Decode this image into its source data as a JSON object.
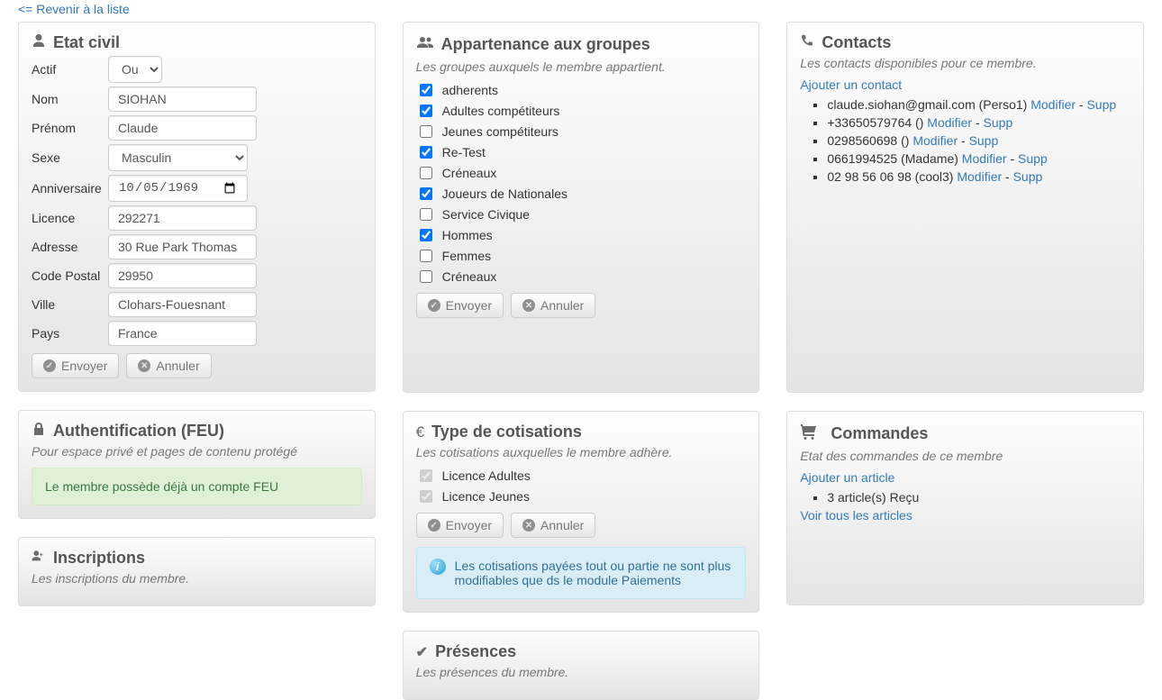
{
  "back_link": "<= Revenir à la liste",
  "civil": {
    "title": "Etat civil",
    "fields": {
      "actif": {
        "label": "Actif",
        "selected": "Oui"
      },
      "nom": {
        "label": "Nom",
        "value": "SIOHAN"
      },
      "prenom": {
        "label": "Prénom",
        "value": "Claude"
      },
      "sexe": {
        "label": "Sexe",
        "selected": "Masculin"
      },
      "anniversaire": {
        "label": "Anniversaire",
        "value": "1969-10-05",
        "display": "05/10/1969"
      },
      "licence": {
        "label": "Licence",
        "value": "292271"
      },
      "adresse": {
        "label": "Adresse",
        "value": "30 Rue Park Thomas"
      },
      "code_postal": {
        "label": "Code Postal",
        "value": "29950"
      },
      "ville": {
        "label": "Ville",
        "value": "Clohars-Fouesnant"
      },
      "pays": {
        "label": "Pays",
        "value": "France"
      }
    },
    "submit": "Envoyer",
    "cancel": "Annuler"
  },
  "auth": {
    "title": "Authentification (FEU)",
    "subtitle": "Pour espace privé et pages de contenu protégé",
    "message": "Le membre possède déjà un compte FEU"
  },
  "groups": {
    "title": "Appartenance aux groupes",
    "subtitle": "Les groupes auxquels le membre appartient.",
    "items": [
      {
        "label": "adherents",
        "checked": true
      },
      {
        "label": "Adultes compétiteurs",
        "checked": true
      },
      {
        "label": "Jeunes compétiteurs",
        "checked": false
      },
      {
        "label": "Re-Test",
        "checked": true
      },
      {
        "label": "Créneaux",
        "checked": false
      },
      {
        "label": "Joueurs de Nationales",
        "checked": true
      },
      {
        "label": "Service Civique",
        "checked": false
      },
      {
        "label": "Hommes",
        "checked": true
      },
      {
        "label": "Femmes",
        "checked": false
      },
      {
        "label": "Créneaux",
        "checked": false
      }
    ],
    "submit": "Envoyer",
    "cancel": "Annuler"
  },
  "cotisations": {
    "title": "Type de cotisations",
    "subtitle": "Les cotisations auxquelles le membre adhère.",
    "items": [
      {
        "label": "Licence Adultes",
        "checked": true,
        "disabled": true
      },
      {
        "label": "Licence Jeunes",
        "checked": true,
        "disabled": true
      }
    ],
    "submit": "Envoyer",
    "cancel": "Annuler",
    "info": "Les cotisations payées tout ou partie ne sont plus modifiables que ds le module Paiements"
  },
  "contacts": {
    "title": "Contacts",
    "subtitle": "Les contacts disponibles pour ce membre.",
    "add_link": "Ajouter un contact",
    "modify": "Modifier",
    "delete": "Supp",
    "items": [
      {
        "value": "claude.siohan@gmail.com",
        "type": "(Perso1)"
      },
      {
        "value": "+33650579764",
        "type": "()"
      },
      {
        "value": "0298560698",
        "type": "()"
      },
      {
        "value": "0661994525",
        "type": "(Madame)"
      },
      {
        "value": "02 98 56 06 98",
        "type": "(cool3)"
      }
    ]
  },
  "orders": {
    "title": "Commandes",
    "subtitle": "Etat des commandes de ce membre",
    "add_link": "Ajouter un article",
    "items": [
      {
        "text": "3 article(s) Reçu"
      }
    ],
    "view_all": "Voir tous les articles"
  },
  "inscriptions": {
    "title": "Inscriptions",
    "subtitle": "Les inscriptions du membre."
  },
  "presences": {
    "title": "Présences",
    "subtitle": "Les présences du membre."
  }
}
